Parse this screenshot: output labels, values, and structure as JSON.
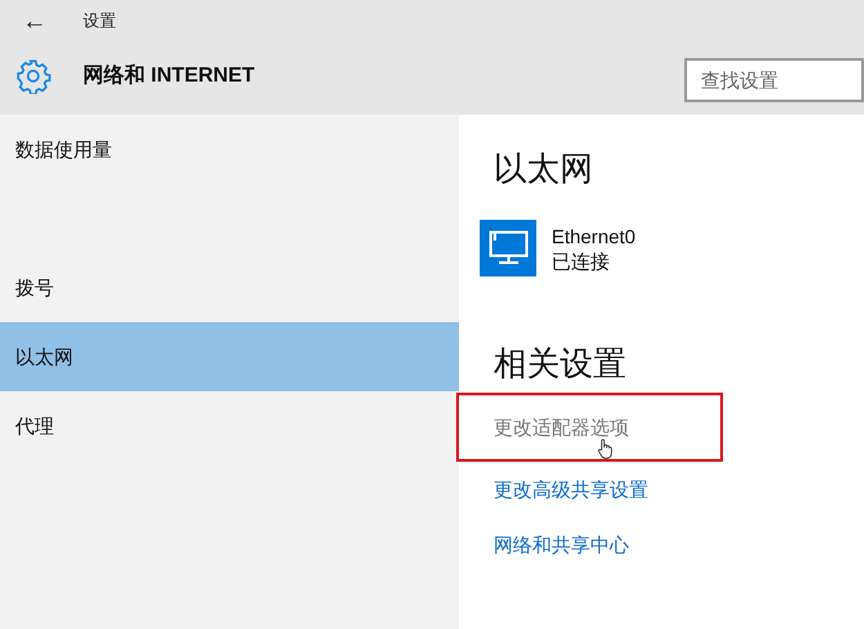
{
  "window": {
    "title": "设置",
    "back": "←"
  },
  "header": {
    "title": "网络和 INTERNET"
  },
  "search": {
    "placeholder": "查找设置"
  },
  "sidebar": {
    "items": [
      {
        "label": "数据使用量",
        "selected": false
      },
      {
        "label": "拨号",
        "selected": false
      },
      {
        "label": "以太网",
        "selected": true
      },
      {
        "label": "代理",
        "selected": false
      }
    ]
  },
  "content": {
    "title": "以太网",
    "network": {
      "name": "Ethernet0",
      "status": "已连接"
    },
    "related_title": "相关设置",
    "links": [
      {
        "label": "更改适配器选项",
        "hovered": true
      },
      {
        "label": "更改高级共享设置",
        "hovered": false
      },
      {
        "label": "网络和共享中心",
        "hovered": false
      }
    ]
  }
}
